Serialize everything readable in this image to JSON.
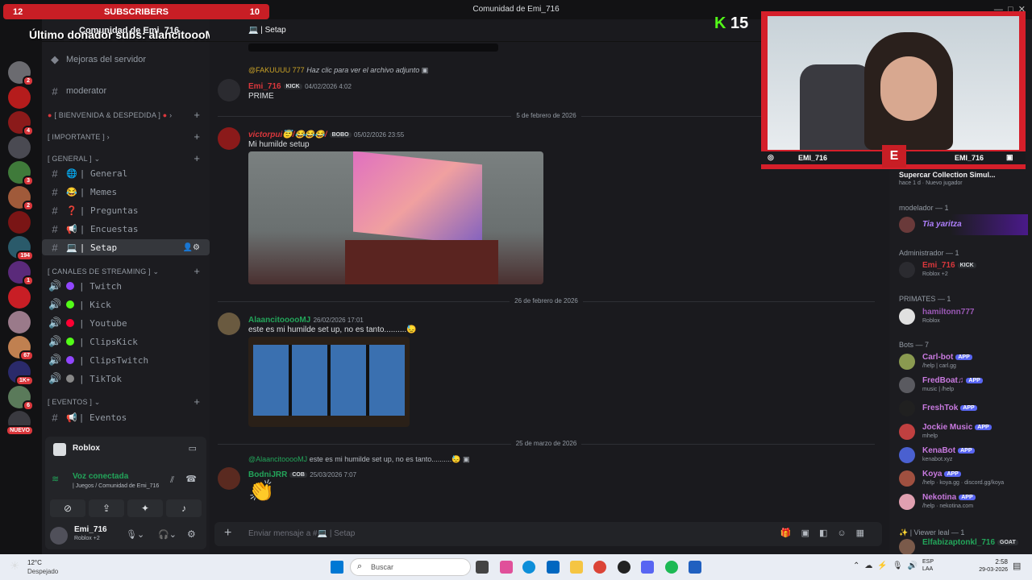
{
  "overlay": {
    "sub_left": "12",
    "sub_title": "SUBSCRIBERS",
    "sub_right": "10",
    "last_donor": "Último donador subs: alancitoooMJ",
    "kick_count": "15",
    "cam_name_left": "EMI_716",
    "cam_name_right": "EMI_716"
  },
  "window": {
    "title": "Comunidad de Emi_716"
  },
  "header": {
    "server": "Comunidad de Emi_716",
    "channel": "Setap"
  },
  "servers": [
    {
      "badge": "2",
      "color": "#6b6b70"
    },
    {
      "badge": "",
      "color": "#b51c1c"
    },
    {
      "badge": "4",
      "color": "#8b1a1a"
    },
    {
      "badge": "",
      "color": "#4a4a52"
    },
    {
      "badge": "3",
      "color": "#3f7a3a"
    },
    {
      "badge": "2",
      "color": "#a05a3a"
    },
    {
      "badge": "",
      "color": "#7a1515"
    },
    {
      "badge": "194",
      "color": "#2a5a6a"
    },
    {
      "badge": "1",
      "color": "#5a2a7a"
    },
    {
      "badge": "",
      "color": "#c81e25"
    },
    {
      "badge": "",
      "color": "#9a7a8a"
    },
    {
      "badge": "67",
      "color": "#c08050"
    },
    {
      "badge": "1K+",
      "color": "#2a2a6a"
    },
    {
      "badge": "6",
      "color": "#5a7a5a"
    },
    {
      "badge": "NUEVO",
      "color": "#3a3a40"
    }
  ],
  "channels": {
    "server_boost": "Mejoras del servidor",
    "moderator": "moderator",
    "cat_bienvenida": "[ BIENVENIDA & DESPEDIDA ]",
    "cat_importante": "[ IMPORTANTE ]",
    "cat_general": "[ GENERAL ]",
    "general_items": [
      {
        "label": "| General",
        "emoji": "🌐"
      },
      {
        "label": "| Memes",
        "emoji": "😂"
      },
      {
        "label": "| Preguntas",
        "emoji": "❓"
      },
      {
        "label": "| Encuestas",
        "emoji": "📢"
      },
      {
        "label": "| Setap",
        "emoji": "💻"
      }
    ],
    "cat_streaming": "[ CANALES DE STREAMING ]",
    "stream_items": [
      {
        "label": "| Twitch",
        "color": "#9146ff"
      },
      {
        "label": "| Kick",
        "color": "#53fc18"
      },
      {
        "label": "| Youtube",
        "color": "#ff0033"
      },
      {
        "label": "| ClipsKick",
        "color": "#53fc18"
      },
      {
        "label": "| ClipsTwitch",
        "color": "#9146ff"
      },
      {
        "label": "| TikTok",
        "color": "#888888"
      }
    ],
    "cat_eventos": "[ EVENTOS ]",
    "eventos": "| Eventos"
  },
  "voice": {
    "activity": "Roblox",
    "status": "Voz conectada",
    "location": "| Juegos / Comunidad de Emi_716"
  },
  "user": {
    "name": "Emi_716",
    "status": "Roblox +2"
  },
  "messages": {
    "m1_reply_user": "@FAKUUUU 777",
    "m1_reply_text": "Haz clic para ver el archivo adjunto",
    "m1_author": "Emi_716",
    "m1_tag": "KICK",
    "m1_time": "04/02/2026 4:02",
    "m1_text": "PRIME",
    "sep1": "5 de febrero de 2026",
    "m2_author": "victorpui😇/😂😂😂/",
    "m2_tag": "BOBO",
    "m2_time": "05/02/2026 23:55",
    "m2_text": "Mi humilde setup",
    "sep2": "26 de febrero de 2026",
    "m3_author": "AlaancitooooMJ",
    "m3_time": "26/02/2026 17:01",
    "m3_text": "este es mi humilde set up, no es tanto..........😓",
    "sep3": "25 de marzo de 2026",
    "m4_reply_user": "@AlaancitooooMJ",
    "m4_reply_text": "este es mi humilde set up, no es tanto..........😓",
    "m4_author": "BodniJRR",
    "m4_tag": "COB",
    "m4_time": "25/03/2026 7:07",
    "m4_text": "👏"
  },
  "composer": {
    "placeholder": "Enviar mensaje a #💻 | Setap"
  },
  "members": {
    "activity_title": "Supercar Collection Simul...",
    "activity_sub": "hace 1 d · Nuevo jugador",
    "g_modelador": "modelador — 1",
    "modelador": "Tia yaritza",
    "g_admin": "Administrador — 1",
    "admin": "Emi_716",
    "admin_tag": "KICK",
    "admin_status": "Roblox +2",
    "g_primates": "PRIMATES — 1",
    "primate": "hamiltonn777",
    "primate_status": "Roblox",
    "g_bots": "Bots — 7",
    "bots": [
      {
        "name": "Carl-bot",
        "status": "/help | carl.gg",
        "color": "#8a9a50"
      },
      {
        "name": "FredBoat♫",
        "status": "music | /help",
        "color": "#5a5a60"
      },
      {
        "name": "FreshTok",
        "status": "",
        "color": "#202020"
      },
      {
        "name": "Jockie Music",
        "status": "mhelp",
        "color": "#c04040"
      },
      {
        "name": "KenaBot",
        "status": "kenabot.xyz",
        "color": "#4a60d0"
      },
      {
        "name": "Koya",
        "status": "/help · koya.gg · discord.gg/koya",
        "color": "#a05040"
      },
      {
        "name": "Nekotina",
        "status": "/help · nekotina.com",
        "color": "#e0a0b0"
      }
    ],
    "app_label": "APP",
    "g_viewer": "✨ | Viewer leal — 1",
    "viewer": "Elfabizaptonkl_716",
    "viewer_tag": "GOAT"
  },
  "taskbar": {
    "temp": "12°C",
    "weather": "Despejado",
    "search": "Buscar",
    "lang1": "ESP",
    "lang2": "LAA",
    "time": "2:58",
    "date": "29-03-2026"
  }
}
